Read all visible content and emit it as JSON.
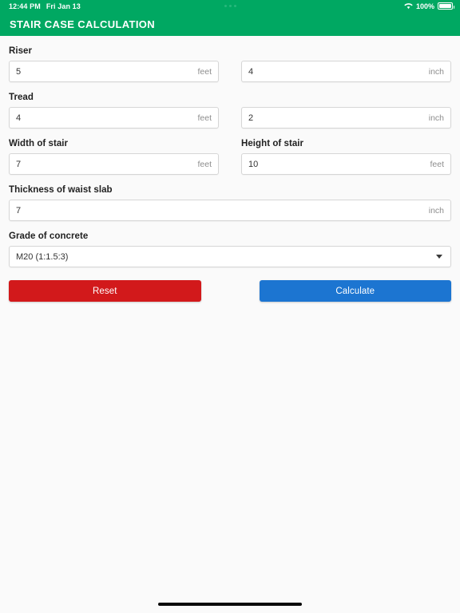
{
  "status_bar": {
    "time": "12:44 PM",
    "date": "Fri Jan 13",
    "battery_percent": "100%",
    "wifi_icon": "wifi-icon",
    "battery_icon": "battery-icon",
    "center_dots": "ellipsis-indicator"
  },
  "app_bar": {
    "title": "STAIR CASE CALCULATION",
    "accent_color": "#00a862"
  },
  "form": {
    "fields": [
      {
        "label": "Riser",
        "left": {
          "name": "riser-feet",
          "value": "5",
          "unit": "feet"
        },
        "right": {
          "name": "riser-inch",
          "value": "4",
          "unit": "inch"
        }
      },
      {
        "label": "Tread",
        "left": {
          "name": "tread-feet",
          "value": "4",
          "unit": "feet"
        },
        "right": {
          "name": "tread-inch",
          "value": "2",
          "unit": "inch"
        }
      }
    ],
    "width_of_stair": {
      "label": "Width of stair",
      "value": "7",
      "unit": "feet"
    },
    "height_of_stair": {
      "label": "Height of stair",
      "value": "10",
      "unit": "feet"
    },
    "thickness_of_waist_slab": {
      "label": "Thickness of waist slab",
      "value": "7",
      "unit": "inch"
    },
    "grade_of_concrete": {
      "label": "Grade of concrete",
      "selected": "M20 (1:1.5:3)"
    }
  },
  "actions": {
    "reset_label": "Reset",
    "reset_color": "#d2191b",
    "calculate_label": "Calculate",
    "calculate_color": "#1c75d1"
  }
}
